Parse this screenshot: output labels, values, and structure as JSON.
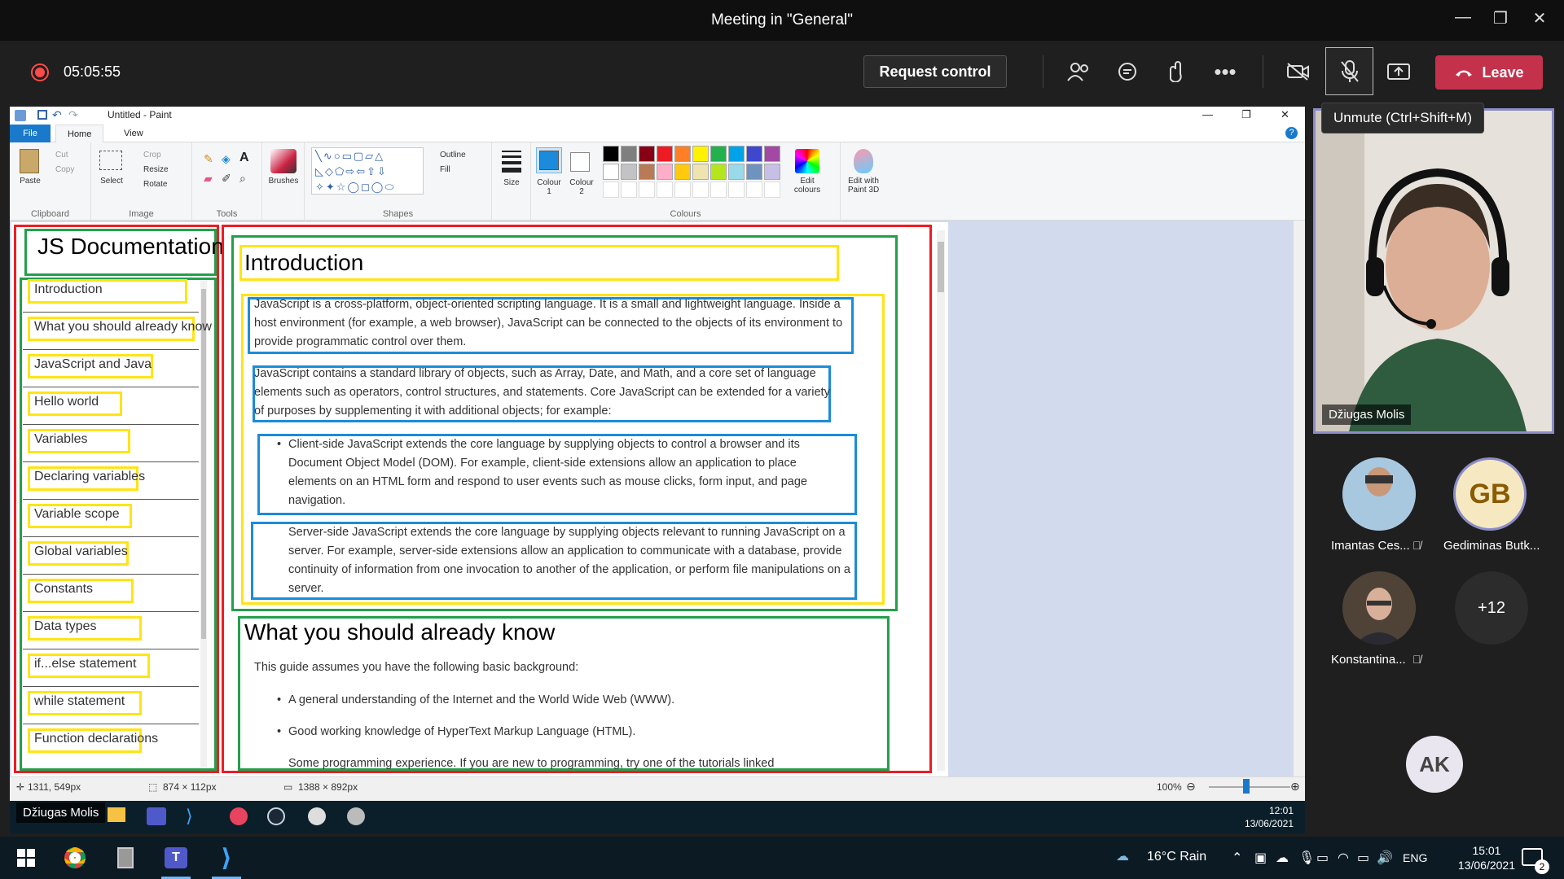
{
  "teams": {
    "window_title": "Meeting in \"General\"",
    "timer": "05:05:55",
    "request_control": "Request control",
    "leave": "Leave",
    "tooltip": "Unmute (Ctrl+Shift+M)",
    "colors": {
      "leave_bg": "#c4314b",
      "record": "#ff4a4a",
      "active_border": "#8b8cc7"
    }
  },
  "paint": {
    "title": "Untitled - Paint",
    "tabs": [
      "File",
      "Home",
      "View"
    ],
    "ribbon": {
      "clipboard": {
        "paste": "Paste",
        "cut": "Cut",
        "copy": "Copy",
        "label": "Clipboard"
      },
      "image": {
        "select": "Select",
        "crop": "Crop",
        "resize": "Resize",
        "rotate": "Rotate",
        "label": "Image"
      },
      "tools": {
        "label": "Tools"
      },
      "brushes": "Brushes",
      "shapes": {
        "outline": "Outline",
        "fill": "Fill",
        "label": "Shapes"
      },
      "size": "Size",
      "colour1": "Colour 1",
      "colour2": "Colour 2",
      "colours_label": "Colours",
      "edit_colours": "Edit colours",
      "paint3d": "Edit with Paint 3D"
    },
    "status": {
      "cursor": "1311, 549px",
      "selection": "874 × 112px",
      "size": "1388 × 892px",
      "zoom": "100%"
    }
  },
  "doc": {
    "sidebar_title": "JS Documentation",
    "nav": [
      "Introduction",
      "What you should already know",
      "JavaScript and Java",
      "Hello world",
      "Variables",
      "Declaring variables",
      "Variable scope",
      "Global variables",
      "Constants",
      "Data types",
      "if...else statement",
      "while statement",
      "Function declarations"
    ],
    "section1_title": "Introduction",
    "p1": "JavaScript is a cross-platform, object-oriented scripting language. It is a small and lightweight language. Inside a host environment (for example, a web browser), JavaScript can be connected to the objects of its environment to provide programmatic control over them.",
    "p2": "JavaScript contains a standard library of objects, such as Array, Date, and Math, and a core set of language elements such as operators, control structures, and statements. Core JavaScript can be extended for a variety of purposes by supplementing it with additional objects; for example:",
    "b1": "Client-side JavaScript extends the core language by supplying objects to control a browser and its Document Object Model (DOM). For example, client-side extensions allow an application to place elements on an HTML form and respond to user events such as mouse clicks, form input, and page navigation.",
    "b2": "Server-side JavaScript extends the core language by supplying objects relevant to running JavaScript on a server. For example, server-side extensions allow an application to communicate with a database, provide continuity of information from one invocation to another of the application, or perform file manipulations on a server.",
    "section2_title": "What you should already know",
    "p3": "This guide assumes you have the following basic background:",
    "list2": [
      "A general understanding of the Internet and the World Wide Web (WWW).",
      "Good working knowledge of HyperText Markup Language (HTML).",
      "Some programming experience. If you are new to programming, try one of the tutorials linked"
    ]
  },
  "inner_taskbar": {
    "name": "Džiugas Molis",
    "time": "12:01",
    "date": "13/06/2021"
  },
  "participants": {
    "main": "Džiugas Molis",
    "p1": "Imantas Ces...",
    "p2_initials": "GB",
    "p2": "Gediminas Butk...",
    "p3": "Konstantina...",
    "more": "+12",
    "ak": "AK"
  },
  "windows": {
    "weather": "16°C  Rain",
    "lang": "ENG",
    "time": "15:01",
    "date": "13/06/2021",
    "notif": "2"
  }
}
